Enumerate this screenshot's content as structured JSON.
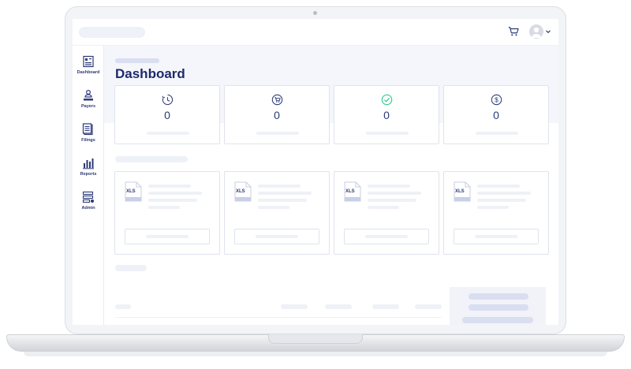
{
  "nav": [
    {
      "label": "Dashboard",
      "icon": "dashboard-icon"
    },
    {
      "label": "Payers",
      "icon": "payers-icon"
    },
    {
      "label": "Filings",
      "icon": "filings-icon"
    },
    {
      "label": "Reports",
      "icon": "reports-icon"
    },
    {
      "label": "Admin",
      "icon": "admin-icon"
    }
  ],
  "page": {
    "title": "Dashboard"
  },
  "stats": [
    {
      "icon": "clock-icon",
      "value": "0",
      "color": "#2b3a78"
    },
    {
      "icon": "cart-icon",
      "value": "0",
      "color": "#2b3a78"
    },
    {
      "icon": "check-circle-icon",
      "value": "0",
      "color": "#2ecc8f"
    },
    {
      "icon": "dollar-icon",
      "value": "0",
      "color": "#2b3a78"
    }
  ],
  "files": [
    {
      "tag": "XLS"
    },
    {
      "tag": "XLS"
    },
    {
      "tag": "XLS"
    },
    {
      "tag": "XLS"
    }
  ],
  "topbar": {
    "cart_icon": "cart-icon",
    "avatar": "user-avatar",
    "menu_icon": "chevron-down-icon"
  },
  "colors": {
    "accent": "#1c2a6b",
    "success": "#2ecc8f",
    "placeholder": "#eef1f6"
  }
}
